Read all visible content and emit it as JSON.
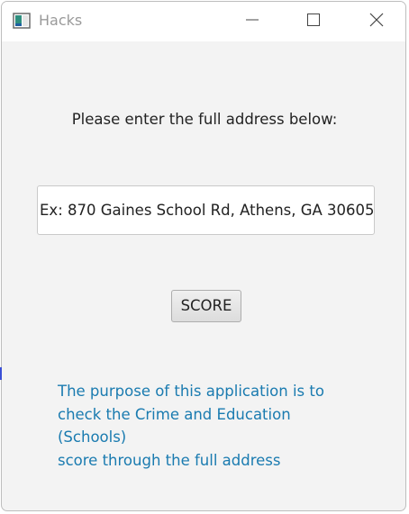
{
  "window": {
    "title": "Hacks",
    "app_icon": "java-app-icon",
    "controls": {
      "minimize_icon": "minimize-icon",
      "maximize_icon": "maximize-icon",
      "close_icon": "close-icon"
    }
  },
  "main": {
    "prompt": "Please enter the full address below:",
    "address_input": {
      "value": "",
      "placeholder": "Ex: 870 Gaines School Rd, Athens, GA 30605"
    },
    "score_button_label": "SCORE",
    "info_lines": [
      "The purpose of this application is to",
      "check the Crime and Education (Schools)",
      "score through the full address"
    ]
  },
  "colors": {
    "window_background": "#f3f3f3",
    "titlebar_background": "#ffffff",
    "info_text": "#1a7bb0",
    "title_text": "#9a9a9a"
  }
}
